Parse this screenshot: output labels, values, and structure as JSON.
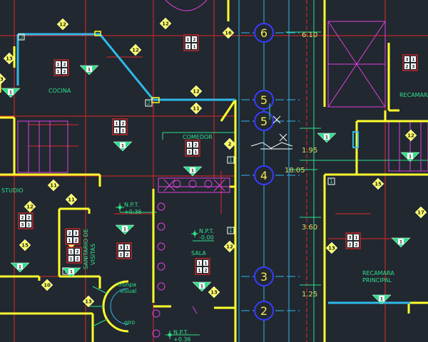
{
  "rooms": [
    {
      "id": "cocina",
      "label": "COCINA"
    },
    {
      "id": "comedor",
      "label": "COMEDOR"
    },
    {
      "id": "sala",
      "label": "SALA"
    },
    {
      "id": "estudio",
      "label": "STUDIO"
    },
    {
      "id": "recamara-top",
      "label": "RECAMARA"
    },
    {
      "id": "recamara-principal-1",
      "label": "RECAMARA"
    },
    {
      "id": "recamara-principal-2",
      "label": "PRINCIPAL"
    },
    {
      "id": "sanitario-1",
      "label": "SANITARIO DE"
    },
    {
      "id": "sanitario-2",
      "label": "VISITAS"
    },
    {
      "id": "tronpa",
      "label": "tronpa"
    },
    {
      "id": "visual",
      "label": "visual"
    },
    {
      "id": "giro",
      "label": "giro"
    }
  ],
  "levels": [
    {
      "id": "npt-sala",
      "line1": "N.P.T.",
      "line2": "-0.00"
    },
    {
      "id": "npt-hall",
      "line1": "N.P.T.",
      "line2": "+0.36"
    },
    {
      "id": "npt-bottom",
      "line1": "N.P.T.",
      "line2": "+0.36"
    }
  ],
  "dimensions": {
    "d610": "6.10",
    "d195": "1.95",
    "d1805": "18.05",
    "d360": "3.60",
    "d125": "1.25"
  },
  "axes": [
    "6",
    "5",
    "5",
    "4",
    "3",
    "2"
  ],
  "tags": {
    "numbered": [
      "12",
      "16",
      "12",
      "11",
      "2",
      "11",
      "11",
      "12",
      "15",
      "11",
      "12",
      "10",
      "13",
      "15",
      "13",
      "17",
      "13",
      "12",
      "12",
      "13",
      "12",
      "13",
      "11",
      "2",
      "1",
      "2"
    ],
    "boxes": [
      "1",
      "2",
      "1",
      "2",
      "1",
      "2",
      "3",
      "1",
      "1",
      "2",
      "1",
      "1",
      "1",
      "2",
      "3",
      "1",
      "2",
      "2",
      "3",
      "1",
      "2",
      "3"
    ]
  },
  "colors": {
    "background": "#212830",
    "wall": "#ffff2e",
    "wall_cyan": "#2fb8e8",
    "red": "#e02828",
    "green": "#2fe08a",
    "magenta": "#e040e0",
    "blue": "#3a3aff",
    "white": "#ffffff"
  }
}
